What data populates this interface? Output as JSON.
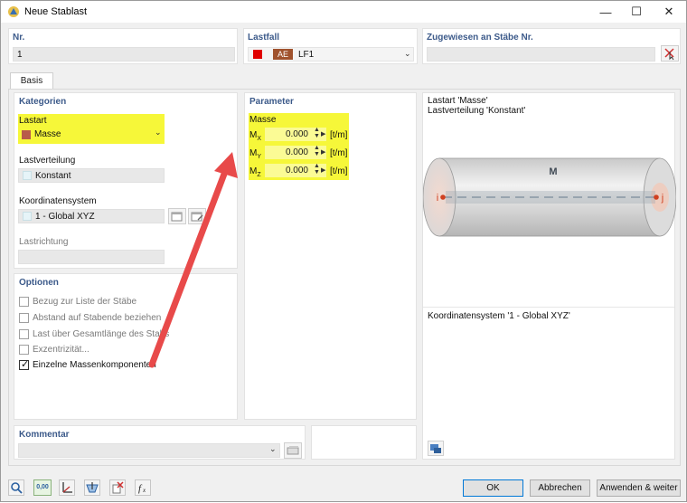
{
  "window": {
    "title": "Neue Stablast",
    "controls": {
      "minimize": "—",
      "maximize": "☐",
      "close": "✕"
    }
  },
  "top": {
    "nr_label": "Nr.",
    "nr_value": "1",
    "lastfall_label": "Lastfall",
    "lastfall_badge": "AE",
    "lastfall_value": "LF1",
    "lastfall_color": "#e00000",
    "lastfall_badge_color": "#a0522d",
    "assigned_label": "Zugewiesen an Stäbe Nr.",
    "assigned_value": ""
  },
  "tabs": [
    {
      "label": "Basis"
    }
  ],
  "kategorien": {
    "header": "Kategorien",
    "lastart_label": "Lastart",
    "lastart_value": "Masse",
    "lastart_color": "#b85c4a",
    "lastverteilung_label": "Lastverteilung",
    "lastverteilung_value": "Konstant",
    "koordsys_label": "Koordinatensystem",
    "koordsys_value": "1 - Global XYZ",
    "lastrichtung_label": "Lastrichtung",
    "lastrichtung_value": ""
  },
  "optionen": {
    "header": "Optionen",
    "items": [
      {
        "label": "Bezug zur Liste der Stäbe",
        "checked": false,
        "enabled": false
      },
      {
        "label": "Abstand auf Stabende beziehen",
        "checked": false,
        "enabled": false
      },
      {
        "label": "Last über Gesamtlänge des Stabs",
        "checked": false,
        "enabled": false
      },
      {
        "label": "Exzentrizität...",
        "checked": false,
        "enabled": false
      },
      {
        "label": "Einzelne Massenkomponenten",
        "checked": true,
        "enabled": true
      }
    ]
  },
  "parameter": {
    "header": "Parameter",
    "group": "Masse",
    "rows": [
      {
        "name": "Mx",
        "sym": "M",
        "sub": "X",
        "value": "0.000",
        "unit": "[t/m]"
      },
      {
        "name": "My",
        "sym": "M",
        "sub": "Y",
        "value": "0.000",
        "unit": "[t/m]"
      },
      {
        "name": "Mz",
        "sym": "M",
        "sub": "Z",
        "value": "0.000",
        "unit": "[t/m]"
      }
    ]
  },
  "preview": {
    "line1": "Lastart 'Masse'",
    "line2": "Lastverteilung 'Konstant'",
    "label_m": "M",
    "node_i": "i",
    "node_j": "j",
    "koord_text": "Koordinatensystem '1 - Global XYZ'"
  },
  "kommentar": {
    "header": "Kommentar",
    "value": ""
  },
  "footer": {
    "ok": "OK",
    "abbrechen": "Abbrechen",
    "anwenden": "Anwenden & weiter",
    "tool_values": {
      "value_tool": "0,00"
    }
  },
  "colors": {
    "highlight": "#f6f739",
    "header_text": "#3c5a8a",
    "arrow": "#e84a4a"
  }
}
